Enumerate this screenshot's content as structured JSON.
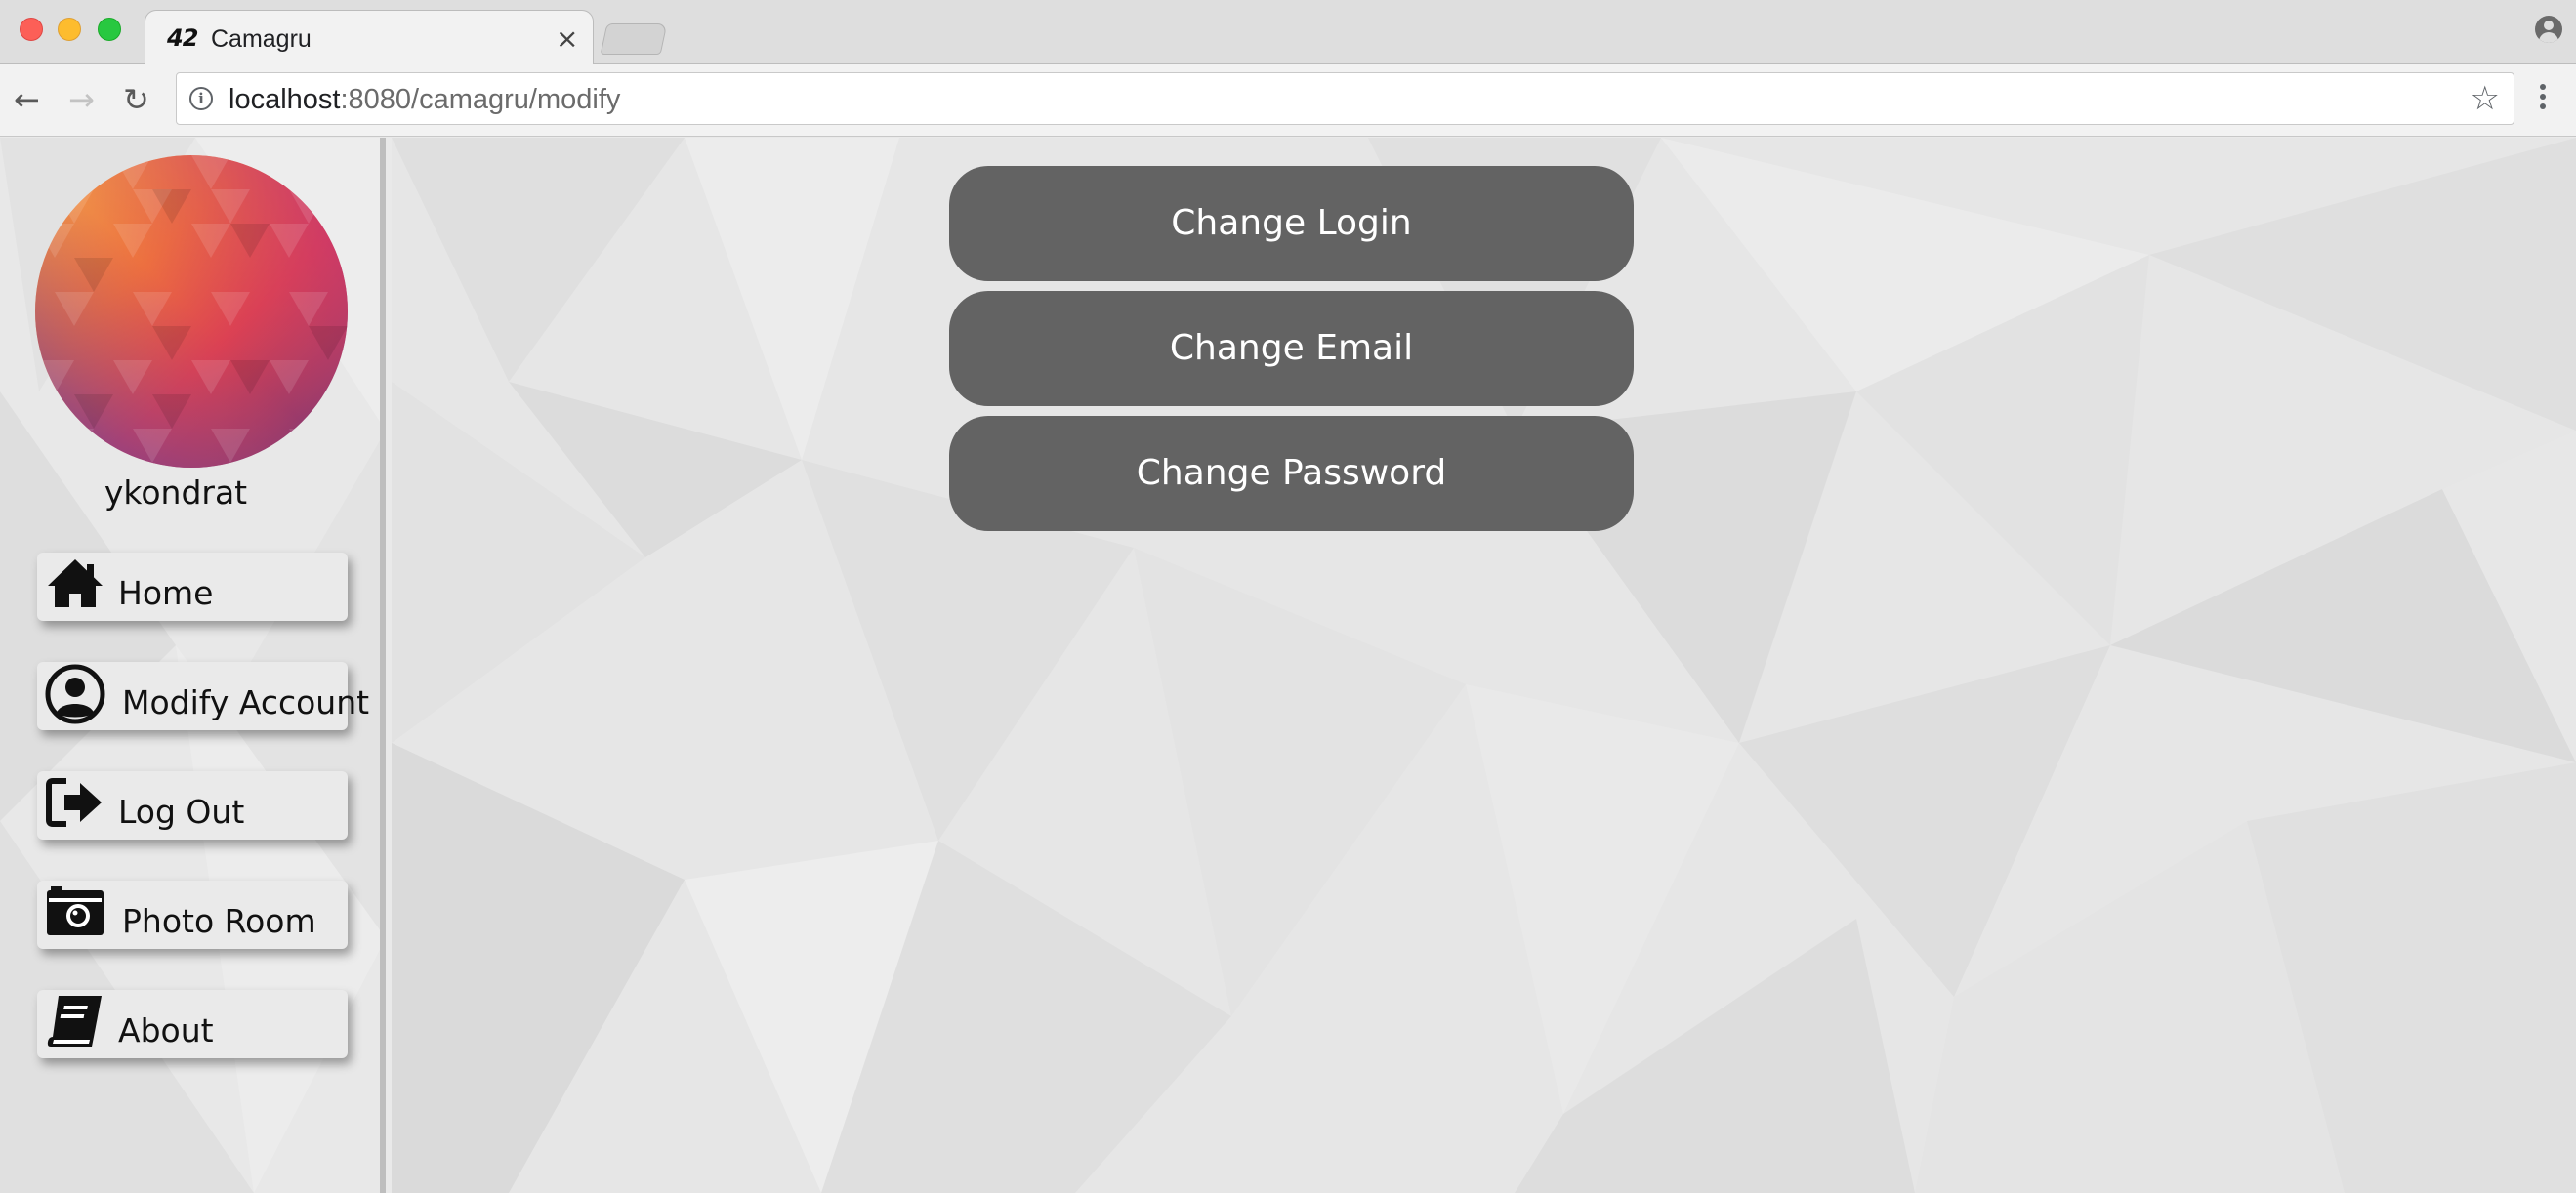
{
  "browser": {
    "tab": {
      "favicon_text": "42",
      "title": "Camagru",
      "close_glyph": "×"
    },
    "address_bar": {
      "url_host": "localhost",
      "url_rest": ":8080/camagru/modify"
    },
    "nav": {
      "back_glyph": "←",
      "forward_glyph": "→",
      "reload_glyph": "↻",
      "bookmark_glyph": "☆"
    },
    "icons": {
      "info": "info-icon",
      "profile": "profile-icon",
      "menu": "kebab-menu-icon",
      "bookmark": "star-icon"
    }
  },
  "sidebar": {
    "username": "ykondrat",
    "items": [
      {
        "label": "Home",
        "icon": "home-icon"
      },
      {
        "label": "Modify Account",
        "icon": "user-circle-icon"
      },
      {
        "label": "Log Out",
        "icon": "sign-out-icon"
      },
      {
        "label": "Photo Room",
        "icon": "camera-icon"
      },
      {
        "label": "About",
        "icon": "book-icon"
      }
    ]
  },
  "main": {
    "buttons": [
      {
        "label": "Change Login"
      },
      {
        "label": "Change Email"
      },
      {
        "label": "Change Password"
      }
    ]
  },
  "colors": {
    "button_bg": "#636363",
    "button_text": "#ffffff",
    "sidebar_bg": "#e8e8e8",
    "page_bg": "#e6e6e6"
  }
}
